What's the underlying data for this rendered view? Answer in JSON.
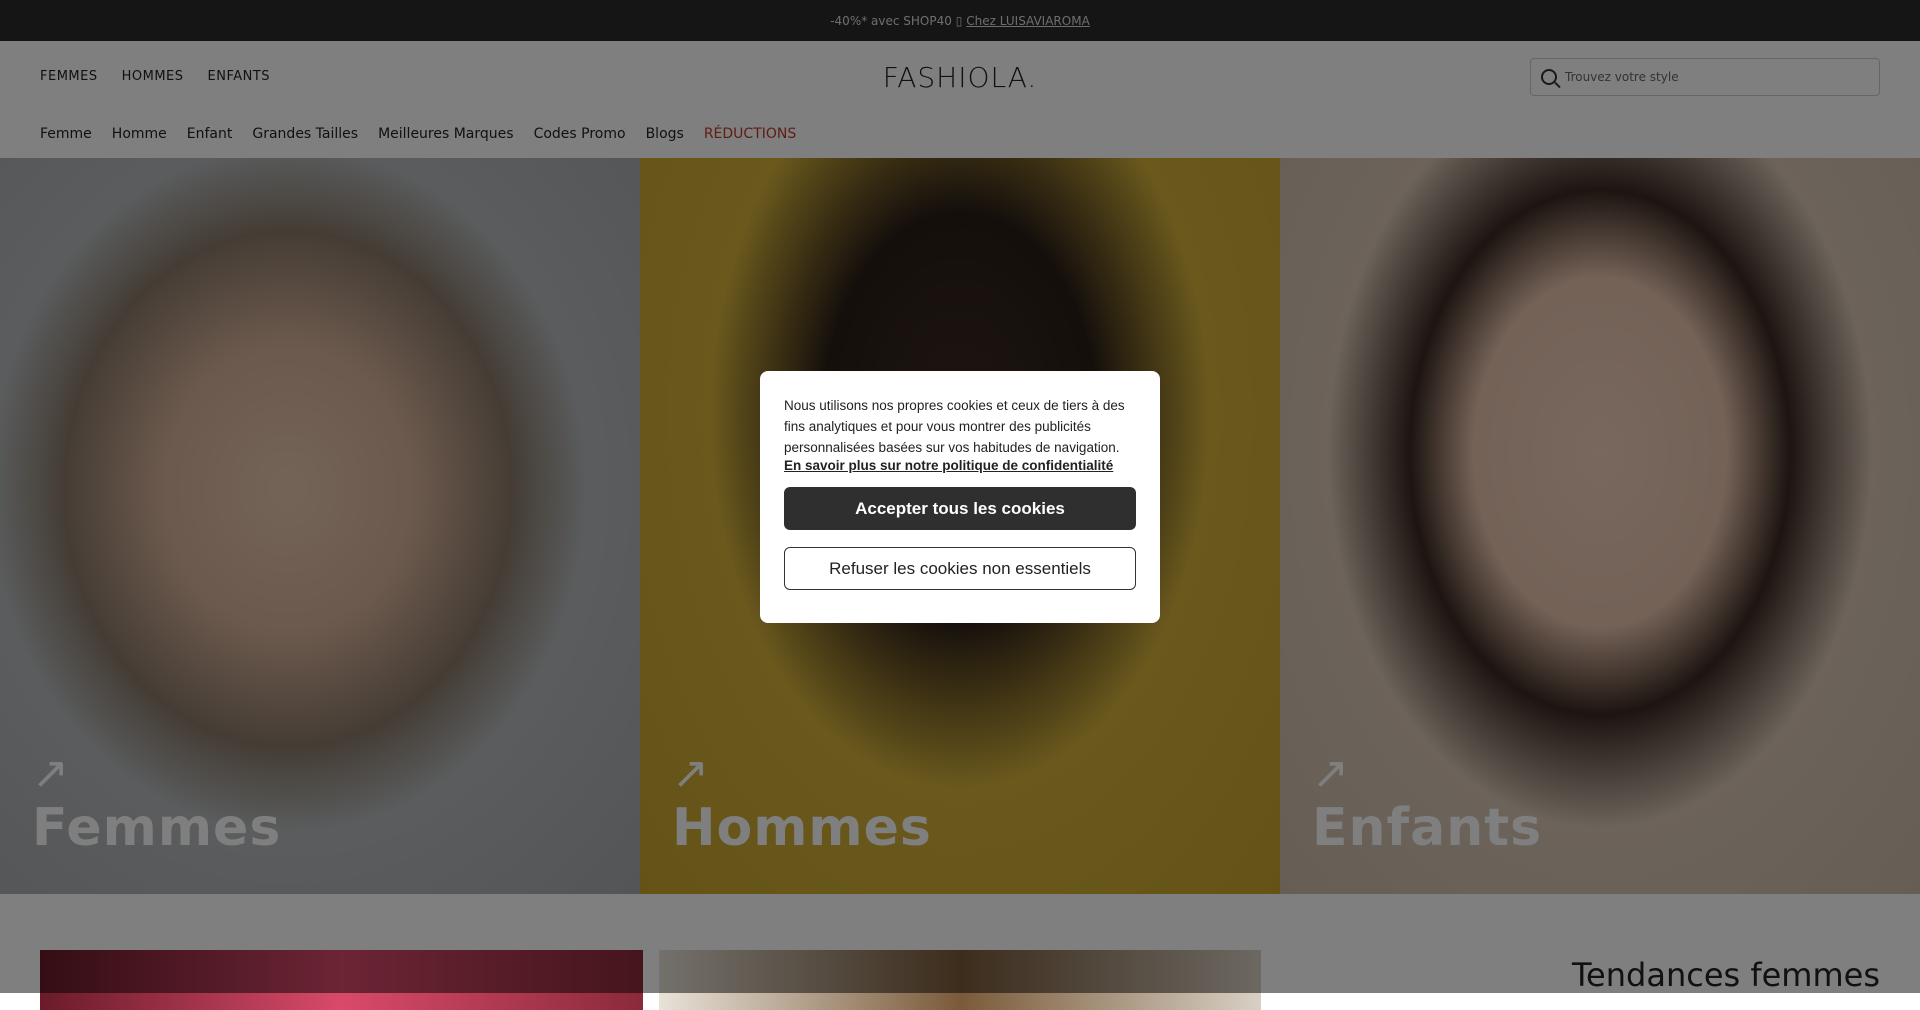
{
  "promo": {
    "text": "-40%* avec SHOP40 ▯",
    "link": "Chez LUISAVIAROMA"
  },
  "header": {
    "topnav": [
      "FEMMES",
      "HOMMES",
      "ENFANTS"
    ],
    "logo": "FASHIOLA.",
    "search": {
      "placeholder": "Trouvez votre style"
    },
    "catnav": [
      "Femme",
      "Homme",
      "Enfant",
      "Grandes Tailles",
      "Meilleures Marques",
      "Codes Promo",
      "Blogs",
      "RÉDUCTIONS"
    ]
  },
  "hero": {
    "panels": [
      {
        "label": "Femmes",
        "arrow": "↗"
      },
      {
        "label": "Hommes",
        "arrow": "↗"
      },
      {
        "label": "Enfants",
        "arrow": "↗"
      }
    ]
  },
  "lower": {
    "trend_title": "Tendances femmes"
  },
  "cookie": {
    "text": "Nous utilisons nos propres cookies et ceux de tiers à des fins analytiques et pour vous montrer des publicités personnalisées basées sur vos habitudes de navigation.",
    "policy_link": "En savoir plus sur notre politique de confidentialité",
    "accept": "Accepter tous les cookies",
    "refuse": "Refuser les cookies non essentiels"
  }
}
